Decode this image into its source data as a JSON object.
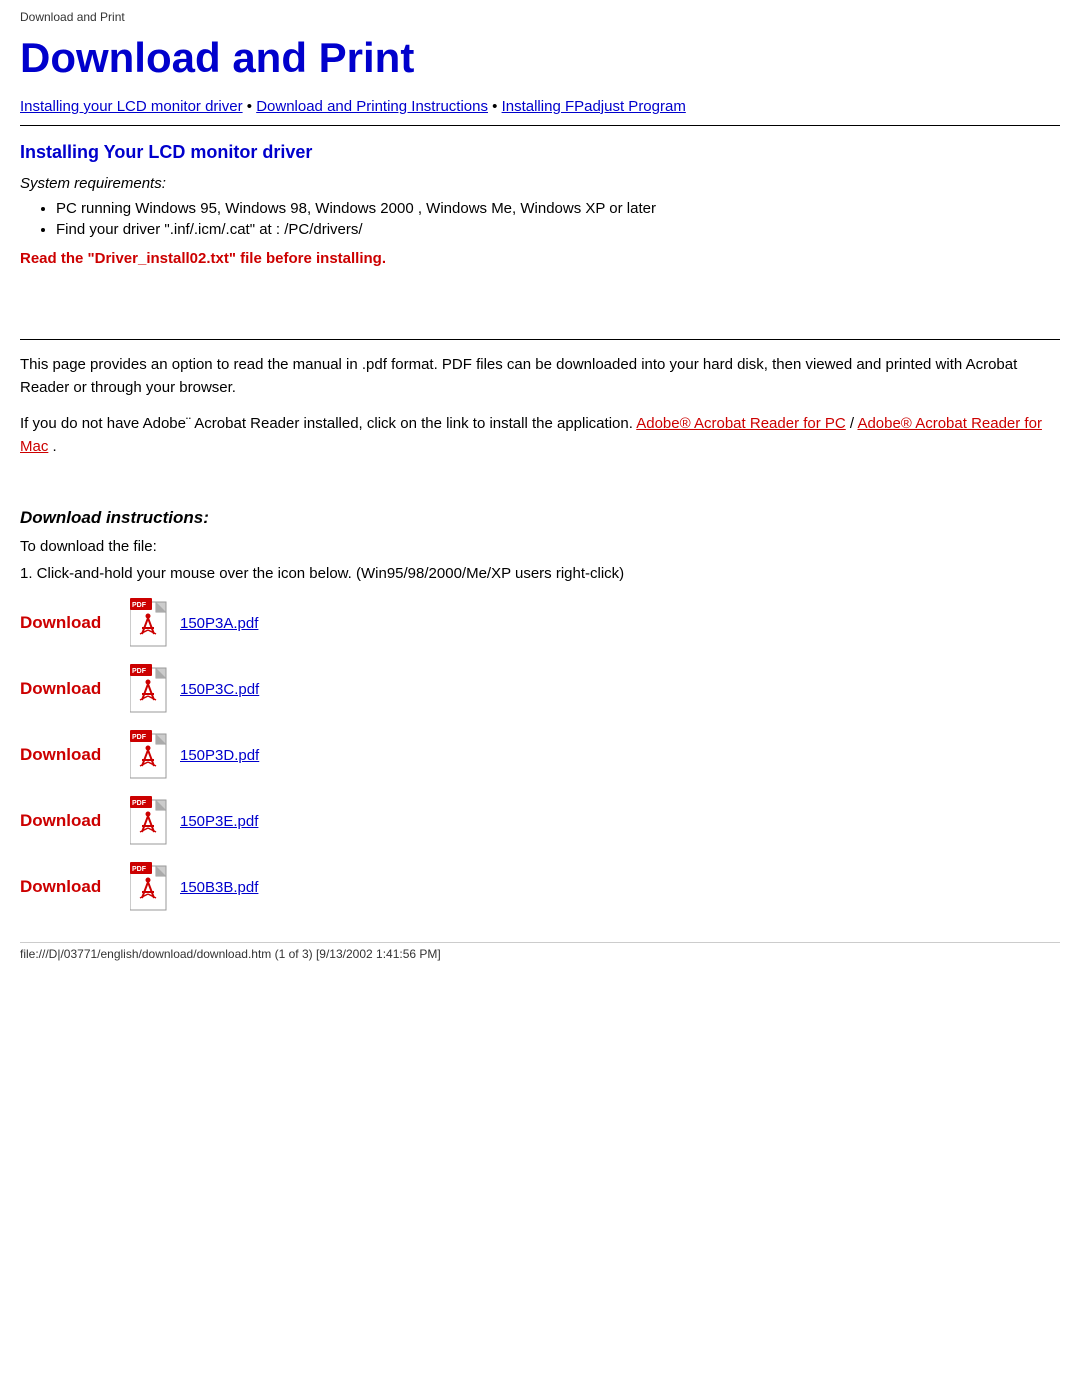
{
  "browser_title": "Download and Print",
  "page_title": "Download and Print",
  "nav": {
    "link1": "Installing your LCD monitor driver",
    "separator1": " • ",
    "link2": "Download and Printing Instructions",
    "separator2": " • ",
    "link3": "Installing FPadjust Program"
  },
  "section1": {
    "title": "Installing Your LCD monitor driver",
    "system_req_label": "System requirements:",
    "bullets": [
      "PC running Windows 95, Windows 98, Windows 2000 , Windows Me, Windows XP or later",
      "Find your driver \".inf/.icm/.cat\" at : /PC/drivers/"
    ],
    "warning": "Read the \"Driver_install02.txt\" file before installing."
  },
  "section2": {
    "description1": "This page provides an option to read the manual in .pdf format. PDF files can be downloaded into your hard disk, then viewed and printed with Acrobat Reader or through your browser.",
    "description2": "If you do not have Adobe¨ Acrobat Reader installed, click on the link to install the application.",
    "acrobat_pc_link": "Adobe® Acrobat Reader for PC",
    "separator": " / ",
    "acrobat_mac_link": "Adobe® Acrobat Reader for Mac"
  },
  "download_section": {
    "title": "Download instructions:",
    "label": "To download the file:",
    "instruction": "1. Click-and-hold your mouse over the icon below. (Win95/98/2000/Me/XP users right-click)",
    "items": [
      {
        "label": "Download",
        "file": "150P3A.pdf"
      },
      {
        "label": "Download",
        "file": "150P3C.pdf"
      },
      {
        "label": "Download",
        "file": "150P3D.pdf"
      },
      {
        "label": "Download",
        "file": "150P3E.pdf"
      },
      {
        "label": "Download",
        "file": "150B3B.pdf"
      }
    ]
  },
  "status_bar": "file:///D|/03771/english/download/download.htm (1 of 3) [9/13/2002 1:41:56 PM]"
}
